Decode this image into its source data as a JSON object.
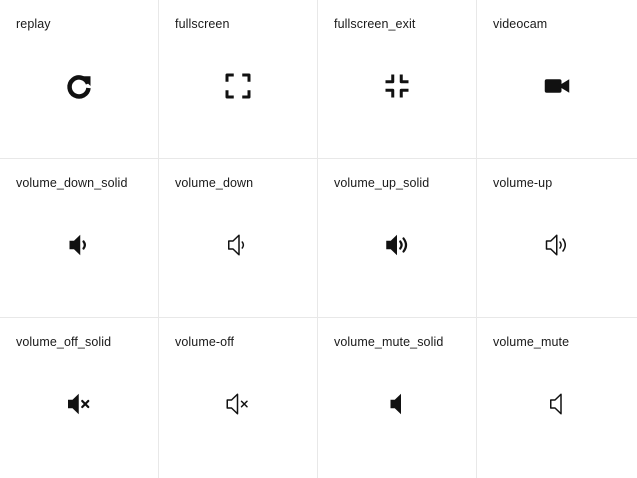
{
  "icon_grid": {
    "items": [
      {
        "label": "replay",
        "icon": "replay-icon"
      },
      {
        "label": "fullscreen",
        "icon": "fullscreen-icon"
      },
      {
        "label": "fullscreen_exit",
        "icon": "fullscreen-exit-icon"
      },
      {
        "label": "videocam",
        "icon": "videocam-icon"
      },
      {
        "label": "volume_down_solid",
        "icon": "volume-down-solid-icon"
      },
      {
        "label": "volume_down",
        "icon": "volume-down-icon"
      },
      {
        "label": "volume_up_solid",
        "icon": "volume-up-solid-icon"
      },
      {
        "label": "volume-up",
        "icon": "volume-up-icon"
      },
      {
        "label": "volume_off_solid",
        "icon": "volume-off-solid-icon"
      },
      {
        "label": "volume-off",
        "icon": "volume-off-icon"
      },
      {
        "label": "volume_mute_solid",
        "icon": "volume-mute-solid-icon"
      },
      {
        "label": "volume_mute",
        "icon": "volume-mute-icon"
      }
    ]
  },
  "colors": {
    "icon": "#111111",
    "text": "#1a1a1a",
    "border": "#e8e8e8",
    "background": "#ffffff"
  }
}
